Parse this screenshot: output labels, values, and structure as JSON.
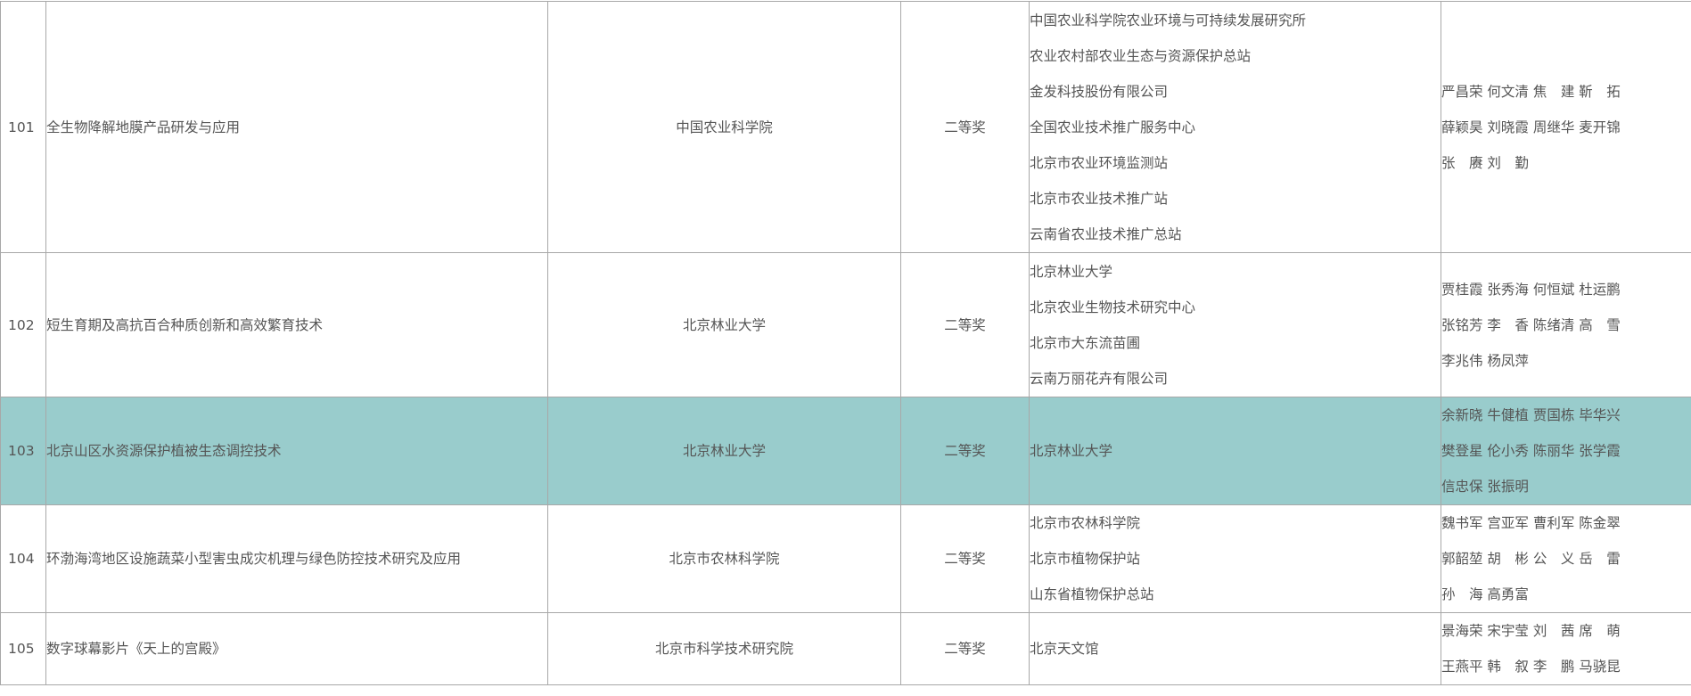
{
  "rows": [
    {
      "num": "101",
      "name": "全生物降解地膜产品研发与应用",
      "nominator": "中国农业科学院",
      "grade": "二等奖",
      "orgs": [
        "中国农业科学院农业环境与可持续发展研究所",
        "农业农村部农业生态与资源保护总站",
        "金发科技股份有限公司",
        "全国农业技术推广服务中心",
        "北京市农业环境监测站",
        "北京市农业技术推广站",
        "云南省农业技术推广总站"
      ],
      "people": [
        "严昌荣 何文清 焦　建 靳　拓",
        "薛颖昊 刘晓霞 周继华 麦开锦",
        "张　赓 刘　勤"
      ]
    },
    {
      "num": "102",
      "name": "短生育期及高抗百合种质创新和高效繁育技术",
      "nominator": "北京林业大学",
      "grade": "二等奖",
      "orgs": [
        "北京林业大学",
        "北京农业生物技术研究中心",
        "北京市大东流苗圃",
        "云南万丽花卉有限公司"
      ],
      "people": [
        "贾桂霞 张秀海 何恒斌 杜运鹏",
        "张铭芳 李　香 陈绪清 高　雪",
        "李兆伟 杨凤萍"
      ]
    },
    {
      "num": "103",
      "name": "北京山区水资源保护植被生态调控技术",
      "nominator": "北京林业大学",
      "grade": "二等奖",
      "orgs": [
        "北京林业大学"
      ],
      "people": [
        "余新晓 牛健植 贾国栋 毕华兴",
        "樊登星 伦小秀 陈丽华 张学霞",
        "信忠保 张振明"
      ]
    },
    {
      "num": "104",
      "name": "环渤海湾地区设施蔬菜小型害虫成灾机理与绿色防控技术研究及应用",
      "nominator": "北京市农林科学院",
      "grade": "二等奖",
      "orgs": [
        "北京市农林科学院",
        "北京市植物保护站",
        "山东省植物保护总站"
      ],
      "people": [
        "魏书军 宫亚军 曹利军 陈金翠",
        "郭韶堃 胡　彬 公　义 岳　雷",
        "孙　海 高勇富"
      ]
    },
    {
      "num": "105",
      "name": "数字球幕影片《天上的宫殿》",
      "nominator": "北京市科学技术研究院",
      "grade": "二等奖",
      "orgs": [
        "北京天文馆"
      ],
      "people": [
        "景海荣 宋宇莹 刘　茜 席　萌",
        "王燕平 韩　叙 李　鹏 马骁昆"
      ]
    }
  ],
  "colors": {
    "highlight": "#99cccc",
    "text": "#555555",
    "border": "#a8a8a8"
  }
}
